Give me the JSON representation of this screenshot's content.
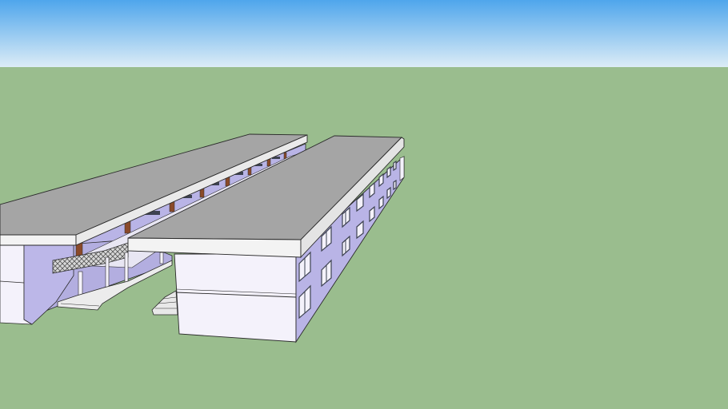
{
  "scene": {
    "description_visible_text": "",
    "colors": {
      "sky_top": "#4fa6ec",
      "sky_bottom": "#dcecf6",
      "ground": "#9abd8e",
      "roof_top": "#a5a5a5",
      "roof_edge": "#f3f3f3",
      "wall_white": "#f4f2fb",
      "wall_lavender": "#b9b4e6",
      "wall_shadow": "#8f8ac0",
      "door_brown": "#8a4a2a",
      "window_dark": "#3d4250",
      "outline": "#2a2a2a"
    }
  }
}
